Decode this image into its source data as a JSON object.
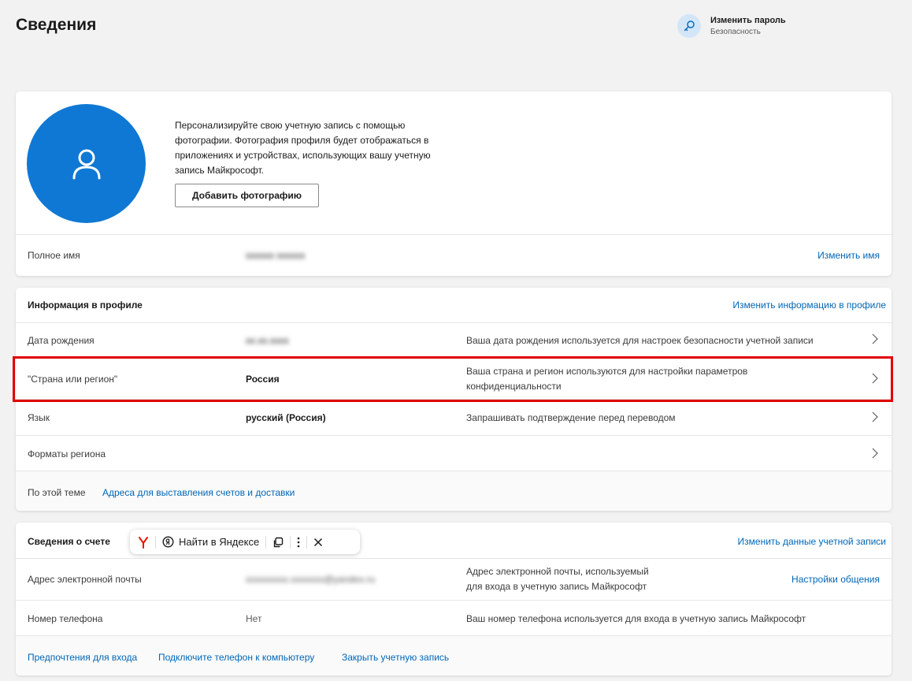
{
  "header": {
    "title": "Сведения",
    "change_password": {
      "title": "Изменить пароль",
      "subtitle": "Безопасность"
    }
  },
  "profile_card": {
    "photo_text": "Персонализируйте свою учетную запись с помощью фотографии. Фотография профиля будет отображаться в приложениях и устройствах, использующих вашу учетную запись Майкрософт.",
    "add_photo_label": "Добавить фотографию",
    "full_name_label": "Полное имя",
    "full_name_value": "xxxxxx xxxxxx",
    "change_name_link": "Изменить имя"
  },
  "profile_info": {
    "title": "Информация в профиле",
    "edit_link": "Изменить информацию в профиле",
    "rows": [
      {
        "label": "Дата рождения",
        "value": "xx.xx.xxxx",
        "desc": "Ваша дата рождения используется для настроек безопасности учетной записи"
      },
      {
        "label": "\"Страна или регион\"",
        "value": "Россия",
        "desc_line1": "Ваша страна и регион используются для настройки параметров",
        "desc_line2": "конфиденциальности"
      },
      {
        "label": "Язык",
        "value": "русский (Россия)",
        "desc": "Запрашивать подтверждение перед переводом"
      },
      {
        "label": "Форматы региона",
        "value": "",
        "desc": ""
      }
    ],
    "related_label": "По этой теме",
    "related_link": "Адреса для выставления счетов и доставки"
  },
  "account_info": {
    "title": "Сведения о счете",
    "edit_link": "Изменить данные учетной записи",
    "email_label": "Адрес электронной почты",
    "email_value": "xxxxxxxxx.xxxxxxx@yandex.ru",
    "email_desc_line1": "Адрес электронной почты, используемый",
    "email_desc_line2": "для входа в учетную запись Майкрософт",
    "email_link": "Настройки общения",
    "phone_label": "Номер телефона",
    "phone_value": "Нет",
    "phone_desc": "Ваш номер телефона используется для входа в учетную запись Майкрософт",
    "footer_links": [
      "Предпочтения для входа",
      "Подключите телефон к компьютеру",
      "Закрыть учетную запись"
    ]
  },
  "yandex_toolbar": {
    "search_label": "Найти в Яндексе"
  },
  "colors": {
    "accent": "#0067b8",
    "avatar": "#0f78d4",
    "highlight": "#e00000"
  }
}
